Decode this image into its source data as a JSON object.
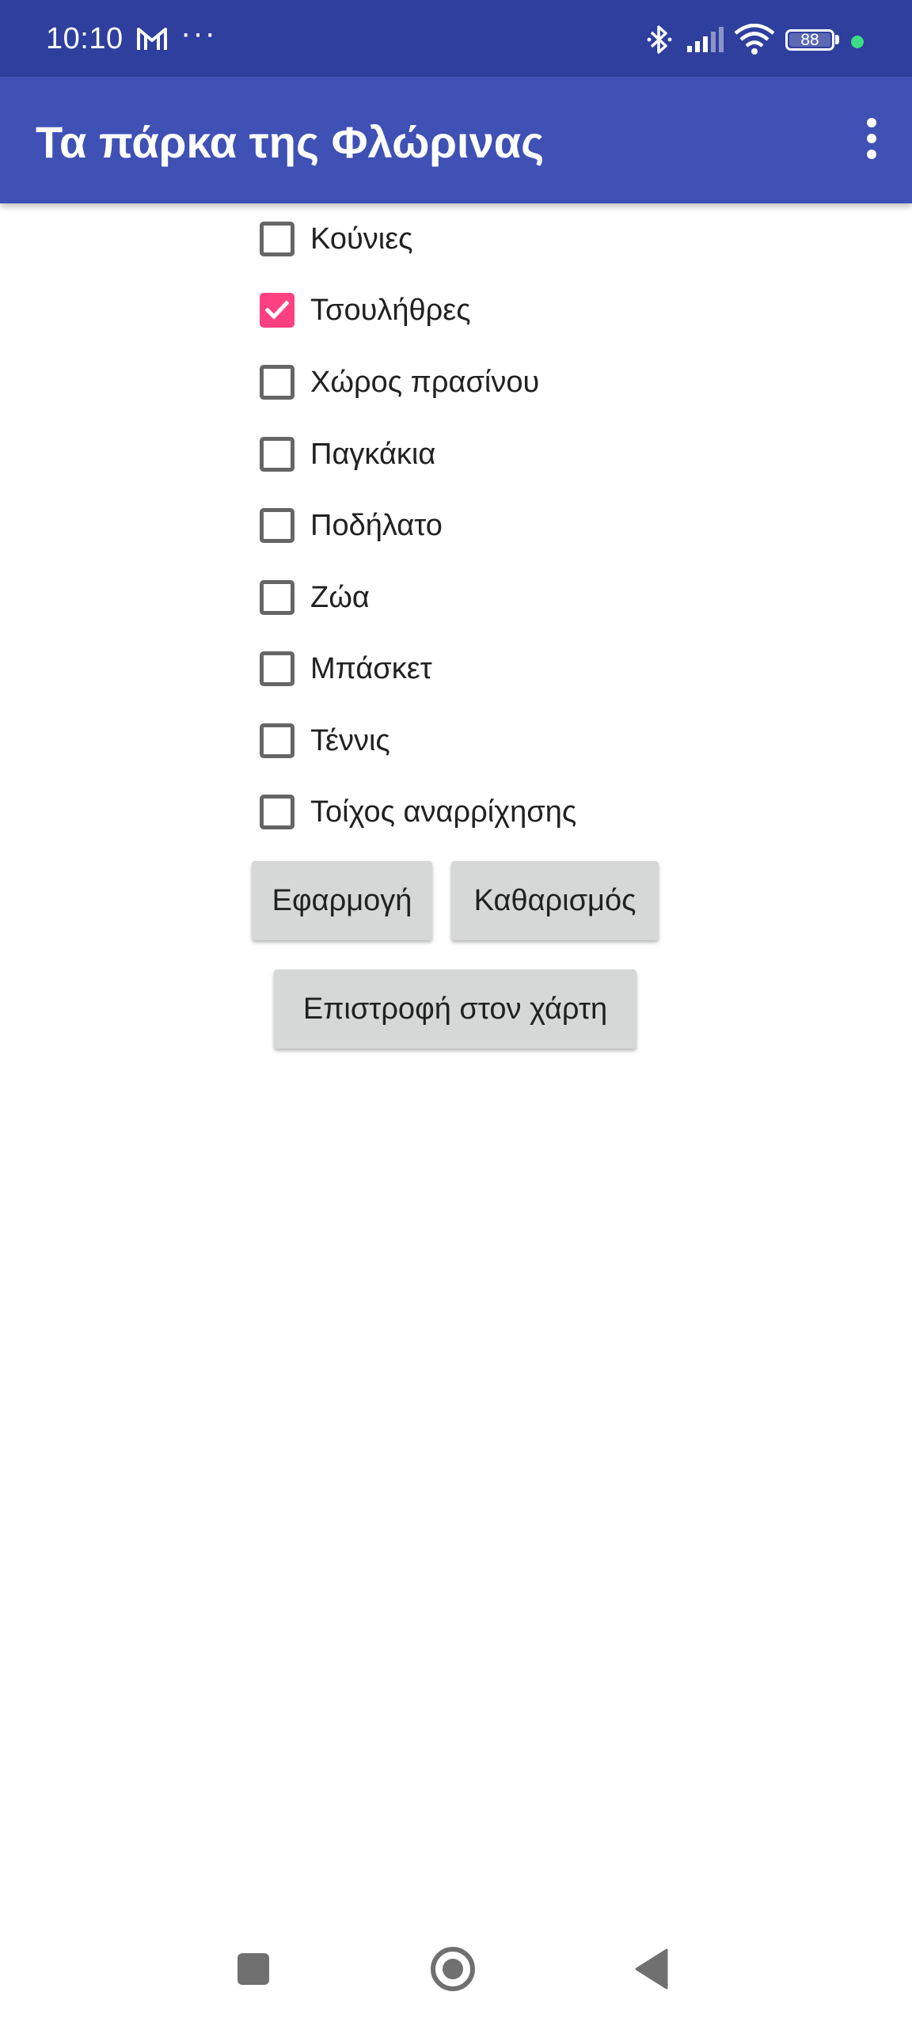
{
  "status_bar": {
    "time": "10:10",
    "overflow_dots": "···",
    "battery_level": "88",
    "notification_icons": [
      "gmail-icon",
      "more-notifications-icon"
    ],
    "system_icons": [
      "bluetooth-icon",
      "signal-icon",
      "wifi-icon",
      "battery-icon"
    ],
    "indicator_color": "#3ddc84"
  },
  "app_bar": {
    "title": "Τα πάρκα της Φλώρινας",
    "menu_icon": "more-vert-icon",
    "color": "#3f51b5"
  },
  "filters": [
    {
      "label": "Κούνιες",
      "checked": false
    },
    {
      "label": "Τσουλήθρες",
      "checked": true
    },
    {
      "label": "Χώρος πρασίνου",
      "checked": false
    },
    {
      "label": "Παγκάκια",
      "checked": false
    },
    {
      "label": "Ποδήλατο",
      "checked": false
    },
    {
      "label": "Ζώα",
      "checked": false
    },
    {
      "label": "Μπάσκετ",
      "checked": false
    },
    {
      "label": "Τέννις",
      "checked": false
    },
    {
      "label": "Τοίχος αναρρίχησης",
      "checked": false
    }
  ],
  "buttons": {
    "apply": "Εφαρμογή",
    "clear": "Καθαρισμός",
    "back_to_map": "Επιστροφή στον χάρτη"
  },
  "colors": {
    "accent": "#ff4081",
    "status_bar": "#2f3f9e"
  },
  "nav_bar": {
    "icons": [
      "recent-apps-icon",
      "home-icon",
      "back-icon"
    ]
  }
}
